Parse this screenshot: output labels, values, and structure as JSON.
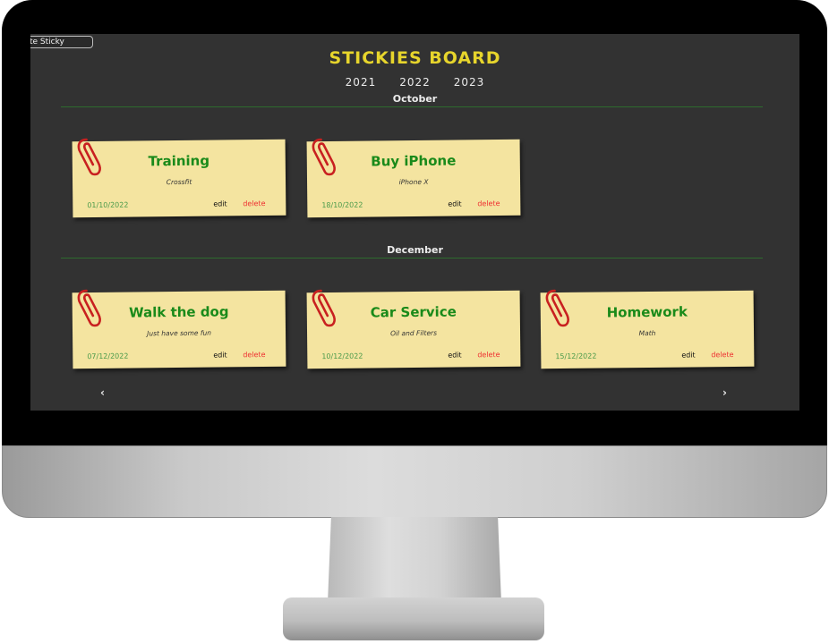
{
  "toolbar": {
    "create_label": "te Sticky"
  },
  "board": {
    "title": "STICKIES BOARD"
  },
  "years": [
    "2021",
    "2022",
    "2023"
  ],
  "colors": {
    "note": "#f4e4a0",
    "title": "#1a8a1a",
    "heading": "#e7d52c",
    "delete": "#e33333"
  },
  "months": [
    {
      "name": "October",
      "notes": [
        {
          "title": "Training",
          "description": "Crossfit",
          "date": "01/10/2022",
          "edit": "edit",
          "delete": "delete"
        },
        {
          "title": "Buy iPhone",
          "description": "iPhone X",
          "date": "18/10/2022",
          "edit": "edit",
          "delete": "delete"
        }
      ]
    },
    {
      "name": "December",
      "notes": [
        {
          "title": "Walk the dog",
          "description": "Just have some fun",
          "date": "07/12/2022",
          "edit": "edit",
          "delete": "delete"
        },
        {
          "title": "Car Service",
          "description": "Oil and Filters",
          "date": "10/12/2022",
          "edit": "edit",
          "delete": "delete"
        },
        {
          "title": "Homework",
          "description": "Math",
          "date": "15/12/2022",
          "edit": "edit",
          "delete": "delete"
        }
      ]
    }
  ],
  "pagination": {
    "prev": "‹",
    "next": "›"
  }
}
